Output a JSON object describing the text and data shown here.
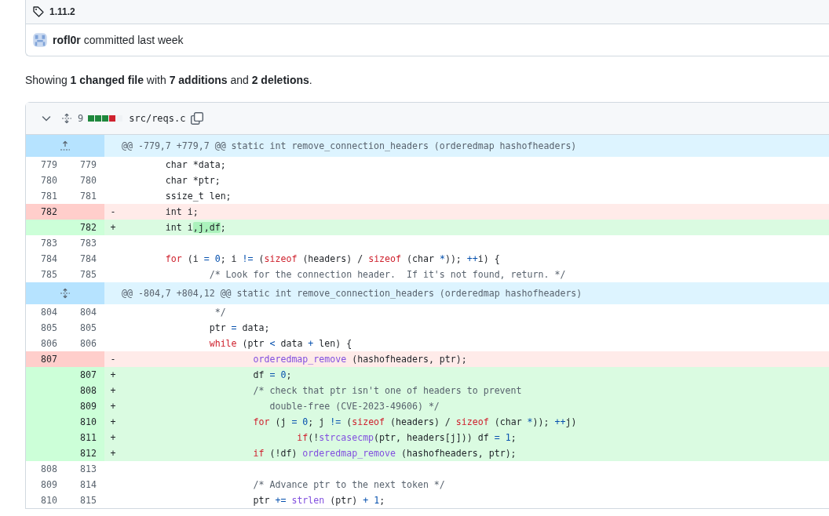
{
  "release": {
    "tag": "1.11.2",
    "author": "rofl0r",
    "action": "committed last week"
  },
  "summary": "Showing **1 changed file** with **7 additions** and **2 deletions**.",
  "file": {
    "expanded": true,
    "changes": "9",
    "diffstat": [
      {
        "color": "#1f883d"
      },
      {
        "color": "#1f883d"
      },
      {
        "color": "#1f883d"
      },
      {
        "color": "#cf222e"
      },
      {
        "color": "#eff2f5"
      }
    ],
    "path": "src/reqs.c"
  },
  "rows": [
    {
      "kind": "hunk-start",
      "text": "@@ -779,7 +779,7 @@ static int remove_connection_headers (orderedmap hashofheaders)"
    },
    {
      "kind": "context",
      "old": "779",
      "new": "779",
      "code": [
        {
          "text": "        char *data;",
          "kind": "plain"
        }
      ]
    },
    {
      "kind": "context",
      "old": "780",
      "new": "780",
      "code": [
        {
          "text": "        char *ptr;",
          "kind": "plain"
        }
      ]
    },
    {
      "kind": "context",
      "old": "781",
      "new": "781",
      "code": [
        {
          "text": "        ssize_t len;",
          "kind": "plain"
        }
      ]
    },
    {
      "kind": "deleted",
      "old": "782",
      "marker": "-",
      "code": [
        {
          "text": "        int i;",
          "kind": "plain"
        }
      ]
    },
    {
      "kind": "added",
      "new": "782",
      "marker": "+",
      "code": [
        {
          "text": "        int i",
          "kind": "plain"
        },
        {
          "text": ",j,df",
          "kind": "plain",
          "changed": true
        },
        {
          "text": ";",
          "kind": "plain"
        }
      ]
    },
    {
      "kind": "context",
      "old": "783",
      "new": "783",
      "code": []
    },
    {
      "kind": "context",
      "old": "784",
      "new": "784",
      "code": [
        {
          "text": "        for",
          "kind": "keyword"
        },
        {
          "text": " (i ",
          "kind": "plain"
        },
        {
          "text": "=",
          "kind": "operator"
        },
        {
          "text": " 0",
          "kind": "number"
        },
        {
          "text": "; i ",
          "kind": "plain"
        },
        {
          "text": "!=",
          "kind": "operator"
        },
        {
          "text": " (",
          "kind": "plain"
        },
        {
          "text": "sizeof",
          "kind": "keyword"
        },
        {
          "text": " (headers) / ",
          "kind": "plain"
        },
        {
          "text": "sizeof",
          "kind": "keyword"
        },
        {
          "text": " (char ",
          "kind": "plain"
        },
        {
          "text": "*",
          "kind": "operator"
        },
        {
          "text": ")); ",
          "kind": "plain"
        },
        {
          "text": "++",
          "kind": "operator"
        },
        {
          "text": "i) {",
          "kind": "plain"
        }
      ]
    },
    {
      "kind": "context",
      "old": "785",
      "new": "785",
      "code": [
        {
          "text": "                /* Look for the connection header.  If it's not found, return. */",
          "kind": "comment"
        }
      ]
    },
    {
      "kind": "hunk",
      "text": "@@ -804,7 +804,12 @@ static int remove_connection_headers (orderedmap hashofheaders)"
    },
    {
      "kind": "context",
      "old": "804",
      "new": "804",
      "code": [
        {
          "text": "                 */",
          "kind": "comment"
        }
      ]
    },
    {
      "kind": "context",
      "old": "805",
      "new": "805",
      "code": [
        {
          "text": "                ptr ",
          "kind": "plain"
        },
        {
          "text": "=",
          "kind": "operator"
        },
        {
          "text": " data;",
          "kind": "plain"
        }
      ]
    },
    {
      "kind": "context",
      "old": "806",
      "new": "806",
      "code": [
        {
          "text": "                while",
          "kind": "keyword"
        },
        {
          "text": " (ptr ",
          "kind": "plain"
        },
        {
          "text": "<",
          "kind": "operator"
        },
        {
          "text": " data ",
          "kind": "plain"
        },
        {
          "text": "+",
          "kind": "operator"
        },
        {
          "text": " len) {",
          "kind": "plain"
        }
      ]
    },
    {
      "kind": "deleted",
      "old": "807",
      "marker": "-",
      "code": [
        {
          "text": "                        orderedmap_remove",
          "kind": "function"
        },
        {
          "text": " (hashofheaders, ptr);",
          "kind": "plain"
        }
      ]
    },
    {
      "kind": "added",
      "new": "807",
      "marker": "+",
      "code": [
        {
          "text": "                        df ",
          "kind": "plain"
        },
        {
          "text": "=",
          "kind": "operator"
        },
        {
          "text": " 0",
          "kind": "number"
        },
        {
          "text": ";",
          "kind": "plain"
        }
      ]
    },
    {
      "kind": "added",
      "new": "808",
      "marker": "+",
      "code": [
        {
          "text": "                        /* check that ptr isn't one of headers to prevent",
          "kind": "comment"
        }
      ]
    },
    {
      "kind": "added",
      "new": "809",
      "marker": "+",
      "code": [
        {
          "text": "                           double-free (CVE-2023-49606) */",
          "kind": "comment"
        }
      ]
    },
    {
      "kind": "added",
      "new": "810",
      "marker": "+",
      "code": [
        {
          "text": "                        for",
          "kind": "keyword"
        },
        {
          "text": " (j ",
          "kind": "plain"
        },
        {
          "text": "=",
          "kind": "operator"
        },
        {
          "text": " 0",
          "kind": "number"
        },
        {
          "text": "; j ",
          "kind": "plain"
        },
        {
          "text": "!=",
          "kind": "operator"
        },
        {
          "text": " (",
          "kind": "plain"
        },
        {
          "text": "sizeof",
          "kind": "keyword"
        },
        {
          "text": " (headers) / ",
          "kind": "plain"
        },
        {
          "text": "sizeof",
          "kind": "keyword"
        },
        {
          "text": " (char ",
          "kind": "plain"
        },
        {
          "text": "*",
          "kind": "operator"
        },
        {
          "text": ")); ",
          "kind": "plain"
        },
        {
          "text": "++",
          "kind": "operator"
        },
        {
          "text": "j)",
          "kind": "plain"
        }
      ]
    },
    {
      "kind": "added",
      "new": "811",
      "marker": "+",
      "code": [
        {
          "text": "                                if",
          "kind": "keyword"
        },
        {
          "text": "(!",
          "kind": "plain"
        },
        {
          "text": "strcasecmp",
          "kind": "function"
        },
        {
          "text": "(ptr, headers[j])) df ",
          "kind": "plain"
        },
        {
          "text": "=",
          "kind": "operator"
        },
        {
          "text": " 1",
          "kind": "number"
        },
        {
          "text": ";",
          "kind": "plain"
        }
      ]
    },
    {
      "kind": "added",
      "new": "812",
      "marker": "+",
      "code": [
        {
          "text": "                        if",
          "kind": "keyword"
        },
        {
          "text": " (!df) ",
          "kind": "plain"
        },
        {
          "text": "orderedmap_remove",
          "kind": "function"
        },
        {
          "text": " (hashofheaders, ptr);",
          "kind": "plain"
        }
      ]
    },
    {
      "kind": "context",
      "old": "808",
      "new": "813",
      "code": []
    },
    {
      "kind": "context",
      "old": "809",
      "new": "814",
      "code": [
        {
          "text": "                        /* Advance ptr to the next token */",
          "kind": "comment"
        }
      ]
    },
    {
      "kind": "context",
      "old": "810",
      "new": "815",
      "code": [
        {
          "text": "                        ptr ",
          "kind": "plain"
        },
        {
          "text": "+=",
          "kind": "operator"
        },
        {
          "text": " strlen",
          "kind": "function"
        },
        {
          "text": " (ptr) ",
          "kind": "plain"
        },
        {
          "text": "+",
          "kind": "operator"
        },
        {
          "text": " 1",
          "kind": "number"
        },
        {
          "text": ";",
          "kind": "plain"
        }
      ]
    }
  ]
}
